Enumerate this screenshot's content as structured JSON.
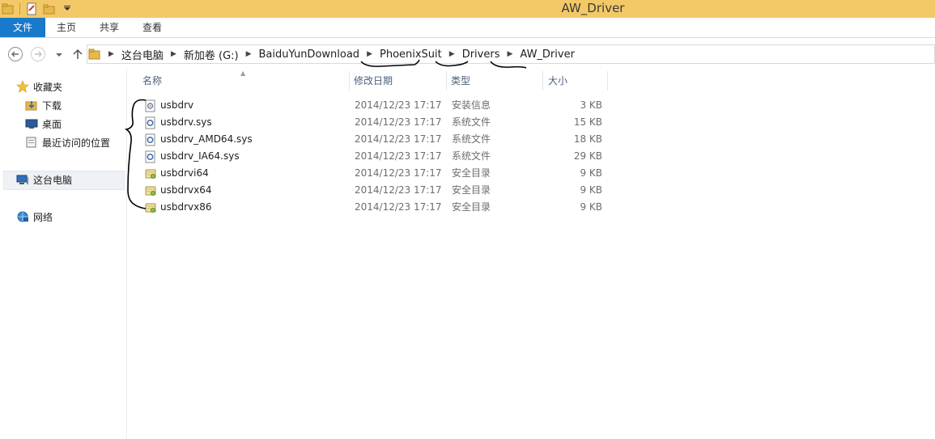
{
  "window": {
    "title": "AW_Driver"
  },
  "ribbon": {
    "file_tab": "文件",
    "tabs": [
      "主页",
      "共享",
      "查看"
    ]
  },
  "address": {
    "breadcrumbs": [
      "这台电脑",
      "新加卷 (G:)",
      "BaiduYunDownload",
      "PhoenixSuit",
      "Drivers",
      "AW_Driver"
    ]
  },
  "navpane": {
    "favorites": "收藏夹",
    "downloads": "下载",
    "desktop": "桌面",
    "recent": "最近访问的位置",
    "this_pc": "这台电脑",
    "network": "网络"
  },
  "columns": {
    "name": "名称",
    "modified": "修改日期",
    "type": "类型",
    "size": "大小"
  },
  "files": [
    {
      "name": "usbdrv",
      "modified": "2014/12/23 17:17",
      "type": "安装信息",
      "size": "3 KB",
      "icon": "setup-info-icon"
    },
    {
      "name": "usbdrv.sys",
      "modified": "2014/12/23 17:17",
      "type": "系统文件",
      "size": "15 KB",
      "icon": "system-file-icon"
    },
    {
      "name": "usbdrv_AMD64.sys",
      "modified": "2014/12/23 17:17",
      "type": "系统文件",
      "size": "18 KB",
      "icon": "system-file-icon"
    },
    {
      "name": "usbdrv_IA64.sys",
      "modified": "2014/12/23 17:17",
      "type": "系统文件",
      "size": "29 KB",
      "icon": "system-file-icon"
    },
    {
      "name": "usbdrvi64",
      "modified": "2014/12/23 17:17",
      "type": "安全目录",
      "size": "9 KB",
      "icon": "security-catalog-icon"
    },
    {
      "name": "usbdrvx64",
      "modified": "2014/12/23 17:17",
      "type": "安全目录",
      "size": "9 KB",
      "icon": "security-catalog-icon"
    },
    {
      "name": "usbdrvx86",
      "modified": "2014/12/23 17:17",
      "type": "安全目录",
      "size": "9 KB",
      "icon": "security-catalog-icon"
    }
  ],
  "colors": {
    "titlebar": "#f3c867",
    "file_tab": "#1979ca",
    "annotation_ink": "#000000"
  }
}
